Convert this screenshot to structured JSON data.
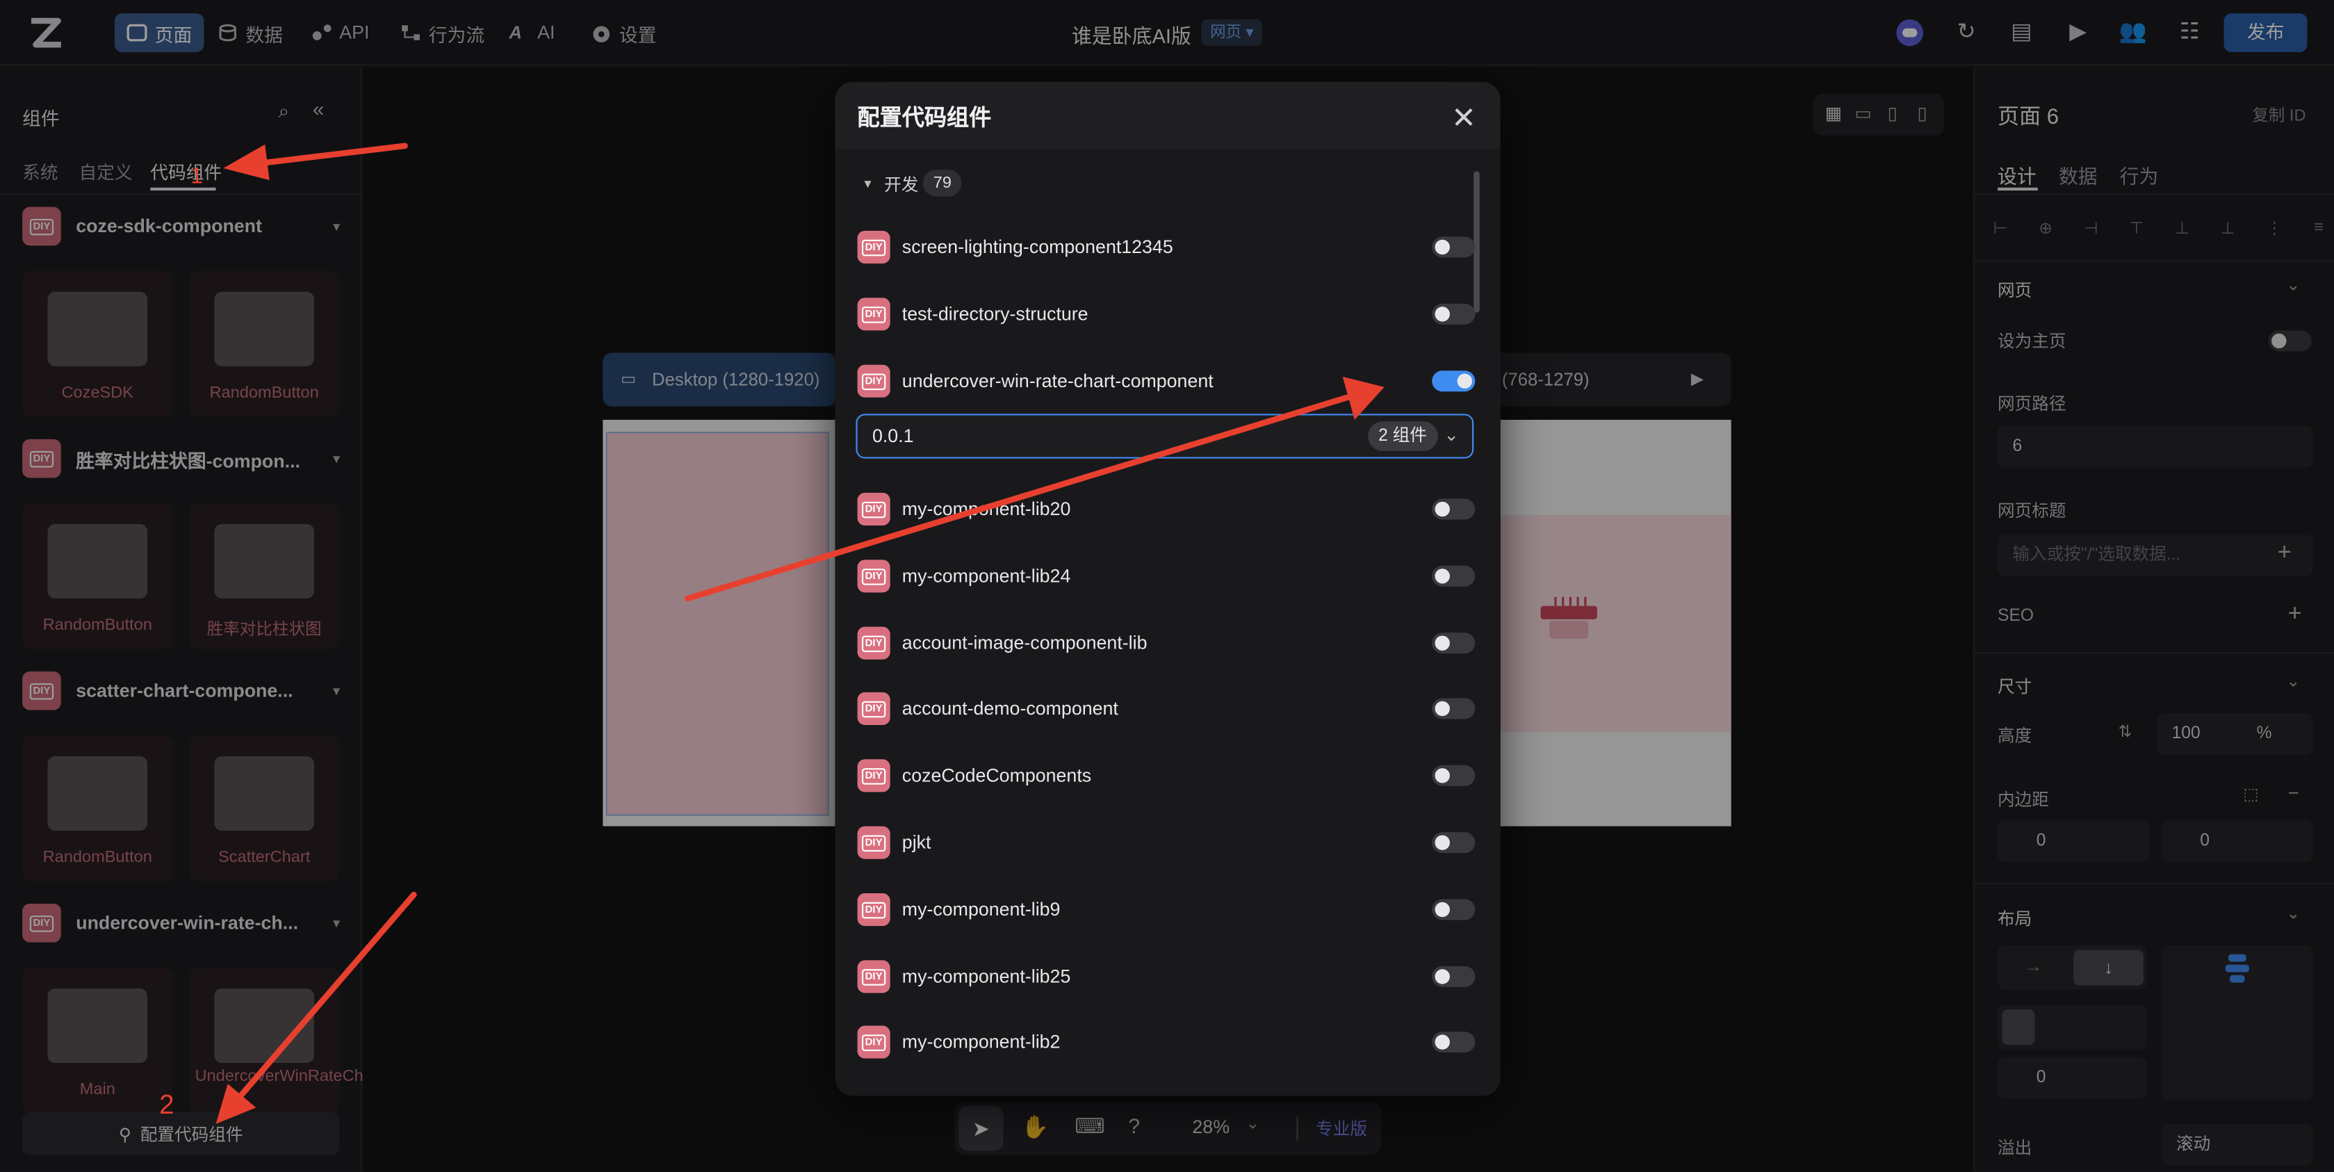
{
  "topbar": {
    "nav": [
      {
        "label": "页面",
        "icon": "page-icon"
      },
      {
        "label": "数据",
        "icon": "database-icon"
      },
      {
        "label": "API",
        "icon": "api-icon"
      },
      {
        "label": "行为流",
        "icon": "workflow-icon"
      },
      {
        "label": "AI",
        "icon": "ai-icon"
      },
      {
        "label": "设置",
        "icon": "gear-icon"
      }
    ],
    "app_title": "谁是卧底AI版",
    "title_badge": "网页 ▾",
    "publish_label": "发布"
  },
  "left_panel": {
    "title": "组件",
    "tabs": [
      "系统",
      "自定义",
      "代码组件"
    ],
    "active_tab": "代码组件",
    "groups": [
      {
        "name": "coze-sdk-component",
        "items": [
          "CozeSDK",
          "RandomButton"
        ]
      },
      {
        "name": "胜率对比柱状图-compon...",
        "items": [
          "RandomButton",
          "胜率对比柱状图"
        ]
      },
      {
        "name": "scatter-chart-compone...",
        "items": [
          "RandomButton",
          "ScatterChart"
        ]
      },
      {
        "name": "undercover-win-rate-ch...",
        "items": [
          "Main",
          "UndercoverWinRateChart"
        ]
      }
    ],
    "config_button": "配置代码组件"
  },
  "canvas": {
    "device_desktop": "Desktop (1280-1920)",
    "device_tablet": "(768-1279)",
    "zoom": "28%",
    "pro_label": "专业版"
  },
  "modal": {
    "title": "配置代码组件",
    "section_label": "开发",
    "section_count": "79",
    "components": [
      {
        "name": "screen-lighting-component12345",
        "enabled": false
      },
      {
        "name": "test-directory-structure",
        "enabled": false
      },
      {
        "name": "undercover-win-rate-chart-component",
        "enabled": true
      },
      {
        "name": "my-component-lib20",
        "enabled": false
      },
      {
        "name": "my-component-lib24",
        "enabled": false
      },
      {
        "name": "account-image-component-lib",
        "enabled": false
      },
      {
        "name": "account-demo-component",
        "enabled": false
      },
      {
        "name": "cozeCodeComponents",
        "enabled": false
      },
      {
        "name": "pjkt",
        "enabled": false
      },
      {
        "name": "my-component-lib9",
        "enabled": false
      },
      {
        "name": "my-component-lib25",
        "enabled": false
      },
      {
        "name": "my-component-lib2",
        "enabled": false
      }
    ],
    "version_value": "0.0.1",
    "version_count": "2 组件"
  },
  "right_panel": {
    "page_title": "页面 6",
    "copy_id": "复制 ID",
    "tabs": [
      "设计",
      "数据",
      "行为"
    ],
    "section_web": "网页",
    "set_home": "设为主页",
    "path_label": "网页路径",
    "path_value": "6",
    "title_label": "网页标题",
    "title_placeholder": "输入或按\"/\"选取数据...",
    "seo_label": "SEO",
    "size_section": "尺寸",
    "height_label": "高度",
    "height_value": "100",
    "height_unit": "%",
    "padding_label": "内边距",
    "padding_h": "0",
    "padding_v": "0",
    "layout_section": "布局",
    "gap_value": "0",
    "overflow_label": "溢出",
    "overflow_value": "滚动"
  },
  "annotations": {
    "step1": "1",
    "step2": "2"
  },
  "colors": {
    "accent": "#3f8cf0",
    "publish": "#2b5ea6",
    "diy": "#d9707f",
    "arrow": "#e8402f"
  }
}
